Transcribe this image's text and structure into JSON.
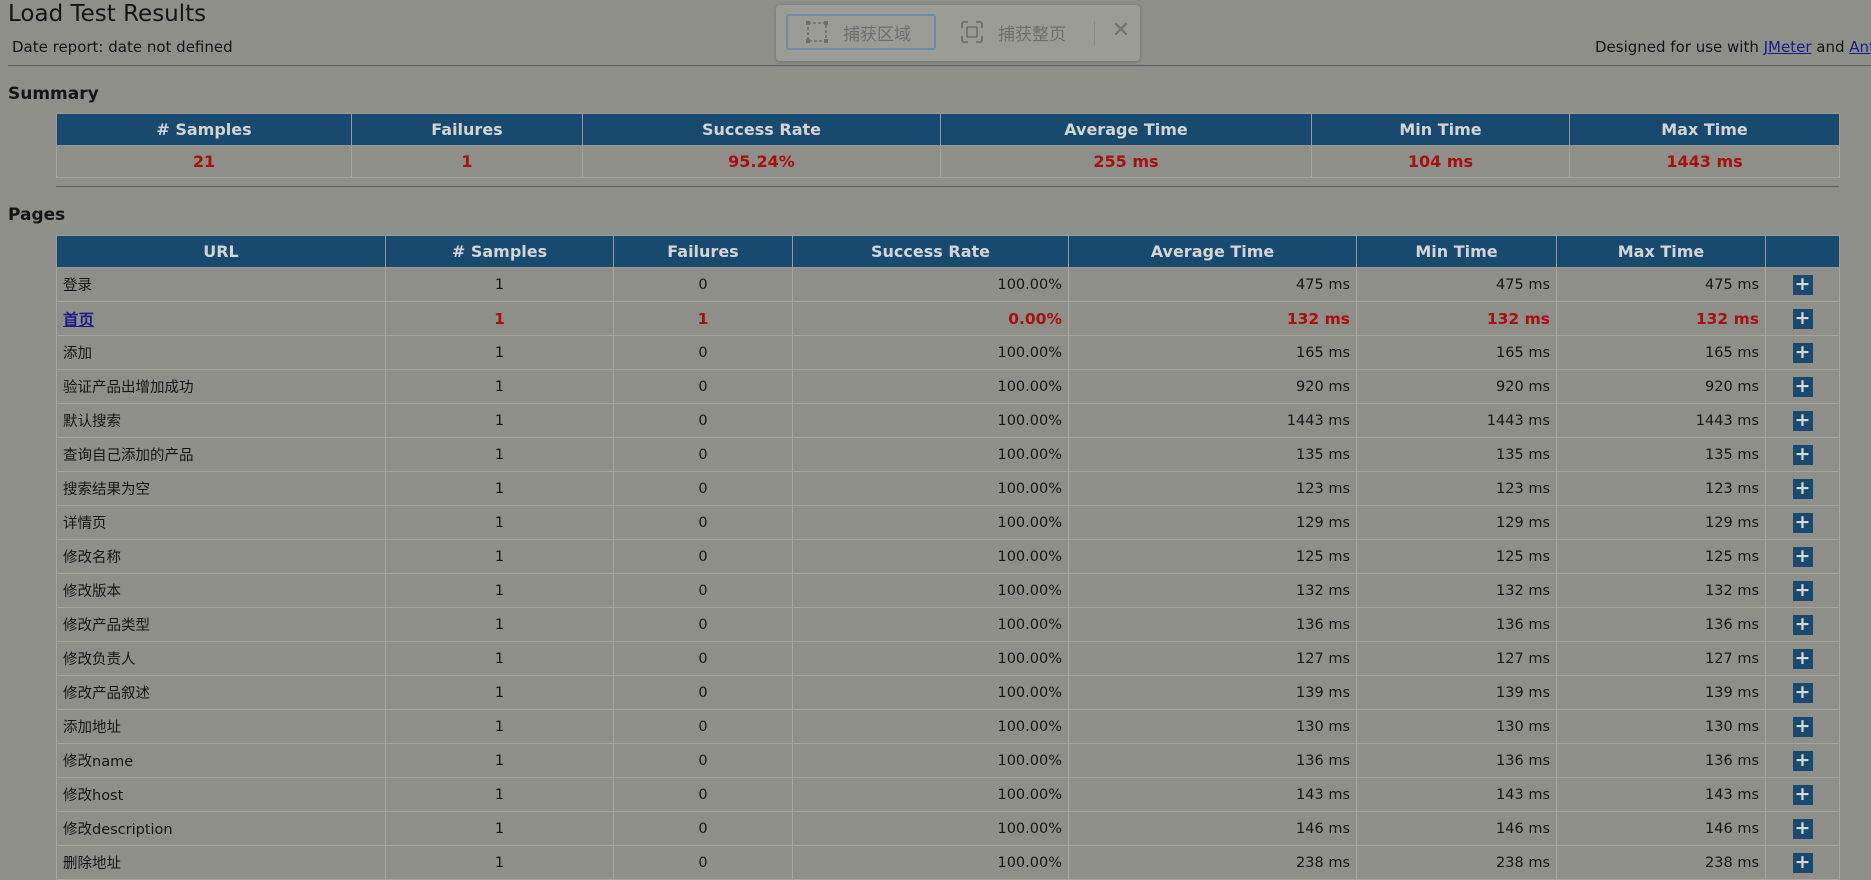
{
  "header": {
    "title": "Load Test Results",
    "date_report": "Date report: date not defined",
    "designed_prefix": "Designed for use with",
    "jmeter_link": "JMeter",
    "and_text": "and",
    "ant_link": "Ant"
  },
  "capture_toolbar": {
    "region_label": "捕获区域",
    "fullpage_label": "捕获整页",
    "close_icon": "close-icon"
  },
  "summary": {
    "heading": "Summary",
    "columns": [
      "# Samples",
      "Failures",
      "Success Rate",
      "Average Time",
      "Min Time",
      "Max Time"
    ],
    "values": [
      "21",
      "1",
      "95.24%",
      "255 ms",
      "104 ms",
      "1443 ms"
    ]
  },
  "pages": {
    "heading": "Pages",
    "columns": [
      "URL",
      "# Samples",
      "Failures",
      "Success Rate",
      "Average Time",
      "Min Time",
      "Max Time",
      ""
    ],
    "rows": [
      {
        "url": "登录",
        "samples": "1",
        "failures": "0",
        "rate": "100.00%",
        "avg": "475 ms",
        "min": "475 ms",
        "max": "475 ms",
        "fail": false
      },
      {
        "url": "首页",
        "samples": "1",
        "failures": "1",
        "rate": "0.00%",
        "avg": "132 ms",
        "min": "132 ms",
        "max": "132 ms",
        "fail": true
      },
      {
        "url": "添加",
        "samples": "1",
        "failures": "0",
        "rate": "100.00%",
        "avg": "165 ms",
        "min": "165 ms",
        "max": "165 ms",
        "fail": false
      },
      {
        "url": "验证产品出增加成功",
        "samples": "1",
        "failures": "0",
        "rate": "100.00%",
        "avg": "920 ms",
        "min": "920 ms",
        "max": "920 ms",
        "fail": false
      },
      {
        "url": "默认搜索",
        "samples": "1",
        "failures": "0",
        "rate": "100.00%",
        "avg": "1443 ms",
        "min": "1443 ms",
        "max": "1443 ms",
        "fail": false
      },
      {
        "url": "查询自己添加的产品",
        "samples": "1",
        "failures": "0",
        "rate": "100.00%",
        "avg": "135 ms",
        "min": "135 ms",
        "max": "135 ms",
        "fail": false
      },
      {
        "url": "搜索结果为空",
        "samples": "1",
        "failures": "0",
        "rate": "100.00%",
        "avg": "123 ms",
        "min": "123 ms",
        "max": "123 ms",
        "fail": false
      },
      {
        "url": "详情页",
        "samples": "1",
        "failures": "0",
        "rate": "100.00%",
        "avg": "129 ms",
        "min": "129 ms",
        "max": "129 ms",
        "fail": false
      },
      {
        "url": "修改名称",
        "samples": "1",
        "failures": "0",
        "rate": "100.00%",
        "avg": "125 ms",
        "min": "125 ms",
        "max": "125 ms",
        "fail": false
      },
      {
        "url": "修改版本",
        "samples": "1",
        "failures": "0",
        "rate": "100.00%",
        "avg": "132 ms",
        "min": "132 ms",
        "max": "132 ms",
        "fail": false
      },
      {
        "url": "修改产品类型",
        "samples": "1",
        "failures": "0",
        "rate": "100.00%",
        "avg": "136 ms",
        "min": "136 ms",
        "max": "136 ms",
        "fail": false
      },
      {
        "url": "修改负责人",
        "samples": "1",
        "failures": "0",
        "rate": "100.00%",
        "avg": "127 ms",
        "min": "127 ms",
        "max": "127 ms",
        "fail": false
      },
      {
        "url": "修改产品叙述",
        "samples": "1",
        "failures": "0",
        "rate": "100.00%",
        "avg": "139 ms",
        "min": "139 ms",
        "max": "139 ms",
        "fail": false
      },
      {
        "url": "添加地址",
        "samples": "1",
        "failures": "0",
        "rate": "100.00%",
        "avg": "130 ms",
        "min": "130 ms",
        "max": "130 ms",
        "fail": false
      },
      {
        "url": "修改name",
        "samples": "1",
        "failures": "0",
        "rate": "100.00%",
        "avg": "136 ms",
        "min": "136 ms",
        "max": "136 ms",
        "fail": false
      },
      {
        "url": "修改host",
        "samples": "1",
        "failures": "0",
        "rate": "100.00%",
        "avg": "143 ms",
        "min": "143 ms",
        "max": "143 ms",
        "fail": false
      },
      {
        "url": "修改description",
        "samples": "1",
        "failures": "0",
        "rate": "100.00%",
        "avg": "146 ms",
        "min": "146 ms",
        "max": "146 ms",
        "fail": false
      },
      {
        "url": "删除地址",
        "samples": "1",
        "failures": "0",
        "rate": "100.00%",
        "avg": "238 ms",
        "min": "238 ms",
        "max": "238 ms",
        "fail": false
      }
    ],
    "expand_icon": "plus-icon"
  },
  "colors": {
    "header_bg": "#174a6e",
    "failure_red": "#a80f0f",
    "link_blue": "#1a1a88"
  }
}
